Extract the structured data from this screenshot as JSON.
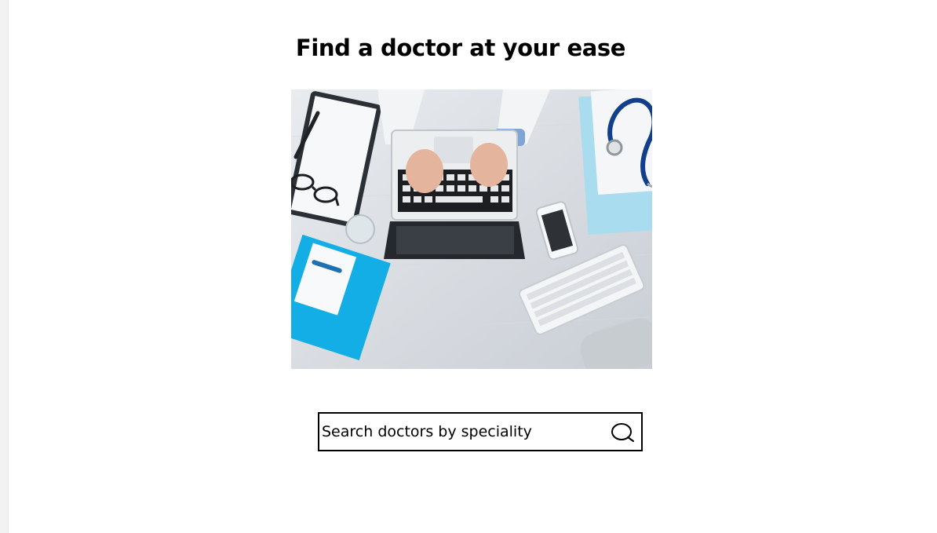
{
  "header": {
    "title": "Find a doctor at your ease"
  },
  "hero": {
    "icon": "doctor-desk-photo"
  },
  "search": {
    "placeholder": "Search doctors by speciality",
    "icon": "search-icon"
  },
  "colors": {
    "background": "#ffffff",
    "text": "#000000",
    "search_border": "#000000",
    "accent_blue": "#1fa9e1"
  }
}
